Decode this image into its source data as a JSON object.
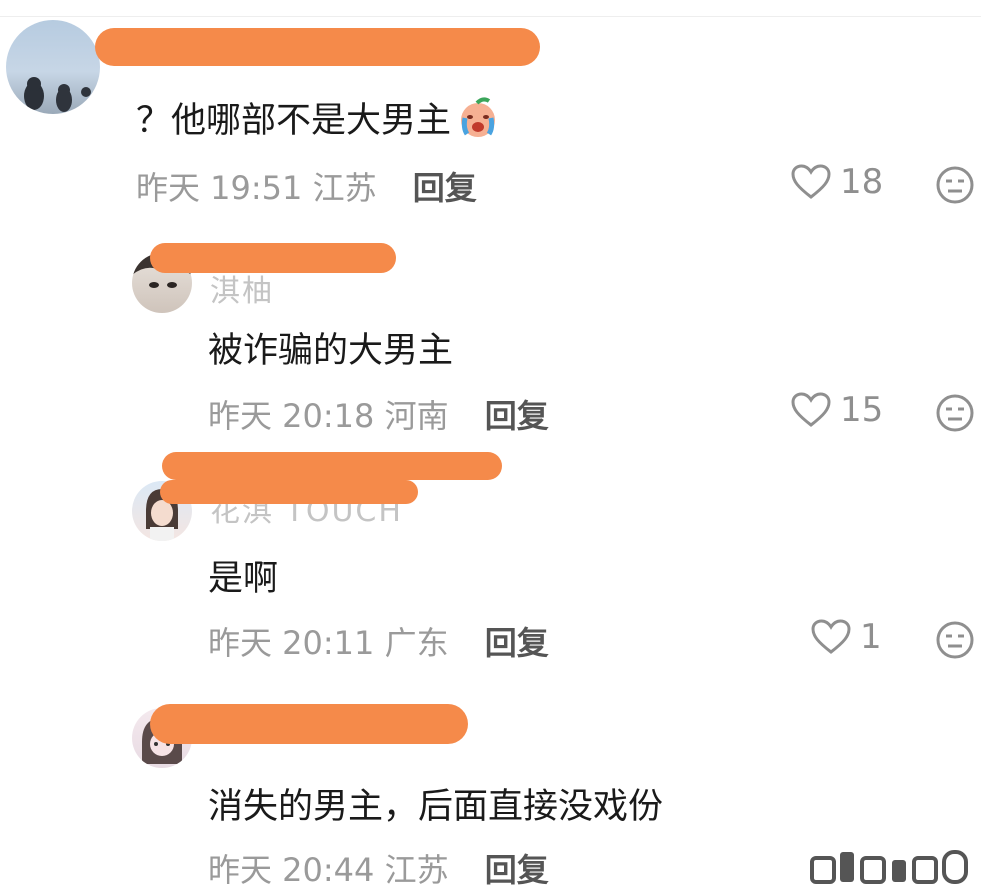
{
  "comments": [
    {
      "text": "？他哪部不是大男主",
      "emoji_icon": "crying-face-icon",
      "time": "昨天 19:51",
      "location": "江苏",
      "reply_label": "回复",
      "likes": "18"
    },
    {
      "username": "淇柚",
      "text": "被诈骗的大男主",
      "time": "昨天 20:18",
      "location": "河南",
      "reply_label": "回复",
      "likes": "15"
    },
    {
      "username": "花淇 TOUCH",
      "text": "是啊",
      "time": "昨天 20:11",
      "location": "广东",
      "reply_label": "回复",
      "likes": "1"
    },
    {
      "text": "消失的男主，后面直接没戏份",
      "time": "昨天 20:44",
      "location": "江苏",
      "reply_label": "回复"
    }
  ],
  "icons": {
    "like": "heart-outline-icon",
    "more": "neutral-face-icon"
  },
  "colors": {
    "redaction": "#f58a4a",
    "meta": "#9a9a9a",
    "text": "#1a1a1a"
  }
}
